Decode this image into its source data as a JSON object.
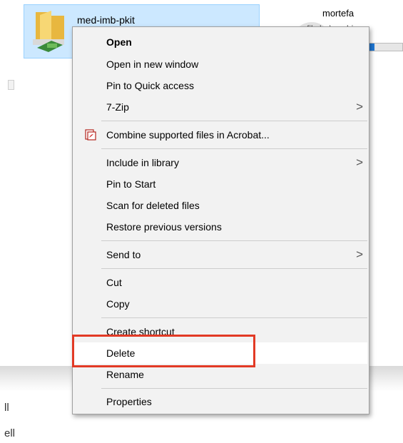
{
  "explorer": {
    "selected_item_name": "med-imb-pkit",
    "other_item": {
      "name": "mortefa",
      "path_text": "file:\\...\\med-i",
      "progress_fraction": 0.15
    },
    "bottom_left_lines": [
      "ll",
      "ell"
    ]
  },
  "context_menu": {
    "items": [
      {
        "label": "Open",
        "bold": true,
        "submenu": false
      },
      {
        "label": "Open in new window",
        "submenu": false
      },
      {
        "label": "Pin to Quick access",
        "submenu": false
      },
      {
        "label": "7-Zip",
        "submenu": true
      },
      {
        "label": "Combine supported files in Acrobat...",
        "icon": "acrobat-icon",
        "submenu": false
      },
      {
        "label": "Include in library",
        "submenu": true
      },
      {
        "label": "Pin to Start",
        "submenu": false
      },
      {
        "label": "Scan for deleted files",
        "submenu": false
      },
      {
        "label": "Restore previous versions",
        "submenu": false
      },
      {
        "label": "Send to",
        "submenu": true
      },
      {
        "label": "Cut",
        "submenu": false
      },
      {
        "label": "Copy",
        "submenu": false
      },
      {
        "label": "Create shortcut",
        "submenu": false
      },
      {
        "label": "Delete",
        "submenu": false,
        "highlighted": true
      },
      {
        "label": "Rename",
        "submenu": false
      },
      {
        "label": "Properties",
        "submenu": false
      }
    ],
    "submenu_arrow_glyph": ">"
  },
  "colors": {
    "selection_bg": "#cce8ff",
    "menu_bg": "#f2f2f2",
    "highlight_outline": "#e23a25",
    "progress_fill": "#1e78d6"
  }
}
